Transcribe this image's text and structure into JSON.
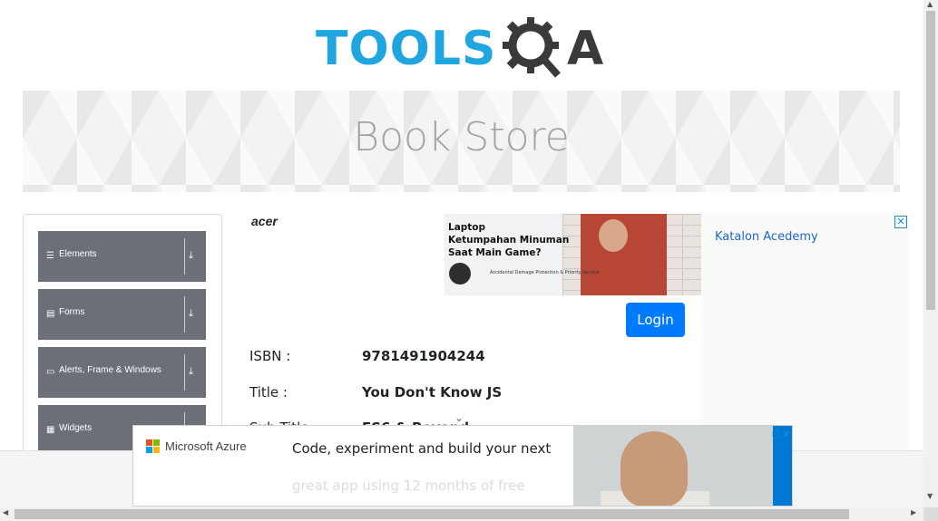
{
  "header": {
    "logo_text": "TOOLS",
    "logo_suffix": "QA"
  },
  "banner": {
    "title": "Book Store"
  },
  "sidebar": {
    "groups": [
      {
        "icon": "☰",
        "label": "Elements"
      },
      {
        "icon": "▤",
        "label": "Forms"
      },
      {
        "icon": "▭",
        "label": "Alerts, Frame & Windows"
      },
      {
        "icon": "▦",
        "label": "Widgets"
      }
    ],
    "expand_icon": "⤓"
  },
  "top_ad": {
    "brand": "acer",
    "line1": "Laptop",
    "line2": "Ketumpahan Minuman",
    "line3": "Saat Main Game?",
    "fine_print": "Accidental Damage Protection & Priority Service"
  },
  "login_button": "Login",
  "book": {
    "isbn_label": "ISBN :",
    "isbn_value": "9781491904244",
    "title_label": "Title :",
    "title_value": "You Don't Know JS",
    "subtitle_label": "Sub Title :",
    "subtitle_value": "ES6 & Beyond"
  },
  "right_ad": {
    "alt_text": "Katalon Acedemy",
    "close": "✕"
  },
  "bottom_ad": {
    "brand": "Microsoft Azure",
    "headline": "Code, experiment and build your next",
    "subline": "great app using 12 months of free",
    "ad_info": "ⓘ✕"
  },
  "scroll_chevron": "⌄",
  "colors": {
    "brand_blue": "#1fa5e0",
    "sidebar_gray": "#6b6f78",
    "primary": "#007bff"
  }
}
